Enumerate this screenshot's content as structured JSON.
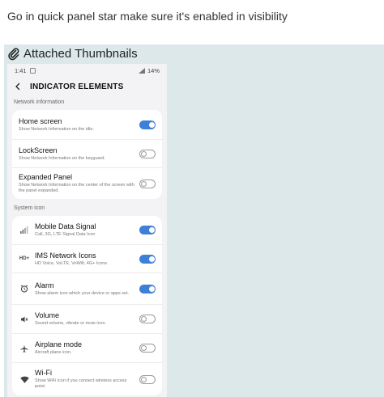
{
  "post": {
    "text": "Go in quick panel star make sure it's enabled in visibility"
  },
  "attachments": {
    "title": "Attached Thumbnails",
    "icon": "paperclip-icon"
  },
  "phone": {
    "status": {
      "time": "1:41",
      "battery": "14%"
    },
    "screen_title": "INDICATOR ELEMENTS",
    "sections": [
      {
        "label": "Network information",
        "items": [
          {
            "title": "Home screen",
            "desc": "Show Network Information on the idle.",
            "on": true,
            "icon": ""
          },
          {
            "title": "LockScreen",
            "desc": "Show Network Information on the keyguard.",
            "on": false,
            "icon": ""
          },
          {
            "title": "Expanded Panel",
            "desc": "Show Network Information on the center of the screen with the panel expanded.",
            "on": false,
            "icon": ""
          }
        ]
      },
      {
        "label": "System icon",
        "items": [
          {
            "title": "Mobile Data Signal",
            "desc": "Call, 3G, LTE Signal Data Icon",
            "on": true,
            "icon": "signal-bars-icon"
          },
          {
            "title": "IMS Network Icons",
            "desc": "HD Voice, VoLTE, VoWifi, 4G+ Icons",
            "on": true,
            "icon": "hd-plus-icon",
            "icon_text": "HD+"
          },
          {
            "title": "Alarm",
            "desc": "Show alarm icon which your device or apps set.",
            "on": true,
            "icon": "alarm-clock-icon"
          },
          {
            "title": "Volume",
            "desc": "Sound volume, vibrate or mute icon.",
            "on": false,
            "icon": "speaker-muted-icon"
          },
          {
            "title": "Airplane mode",
            "desc": "Aircraft plane icon.",
            "on": false,
            "icon": "airplane-icon"
          },
          {
            "title": "Wi-Fi",
            "desc": "Show WiFi icon if you connect wireless access point.",
            "on": false,
            "icon": "wifi-icon"
          }
        ]
      }
    ]
  }
}
